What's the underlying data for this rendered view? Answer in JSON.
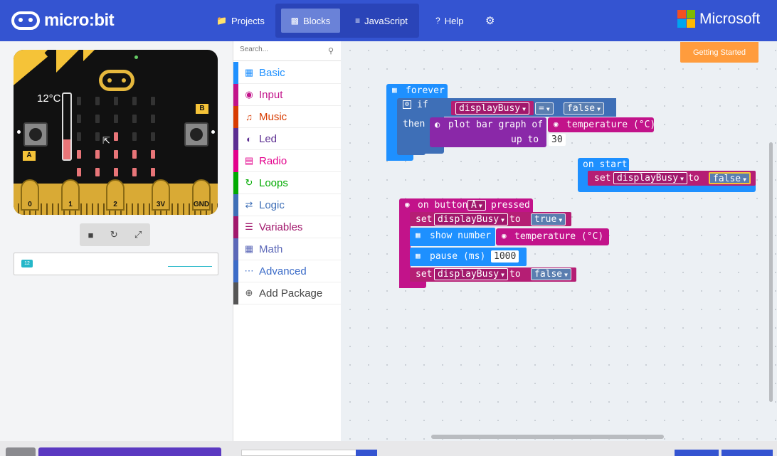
{
  "header": {
    "logo_text": "micro:bit",
    "projects": "Projects",
    "blocks": "Blocks",
    "javascript": "JavaScript",
    "help": "Help",
    "brand": "Microsoft"
  },
  "simulator": {
    "temperature": "12°C",
    "thermometer_level": 0.3,
    "button_a": "A",
    "button_b": "B",
    "pins": [
      "0",
      "1",
      "2",
      "3V",
      "GND"
    ],
    "serial_badge": "12"
  },
  "toolbox": {
    "search_placeholder": "Search...",
    "categories": [
      {
        "label": "Basic",
        "color": "#1e90ff"
      },
      {
        "label": "Input",
        "color": "#c2138a"
      },
      {
        "label": "Music",
        "color": "#d83b01"
      },
      {
        "label": "Led",
        "color": "#5c2d91"
      },
      {
        "label": "Radio",
        "color": "#e3008c"
      },
      {
        "label": "Loops",
        "color": "#00aa00"
      },
      {
        "label": "Logic",
        "color": "#3e6fb7"
      },
      {
        "label": "Variables",
        "color": "#a1186c"
      },
      {
        "label": "Math",
        "color": "#5c68b8"
      },
      {
        "label": "Advanced",
        "color": "#3c6cc8"
      },
      {
        "label": "Add Package",
        "color": "#555555"
      }
    ]
  },
  "workspace": {
    "getting_started": "Getting Started",
    "forever": {
      "label": "forever",
      "if_label": "if",
      "then_label": "then",
      "cond_var": "displayBusy",
      "cond_op": "=",
      "cond_val": "false",
      "plot_label": "plot bar graph of",
      "plot_value": "temperature (°C)",
      "upto_label": "up to",
      "upto_value": "30"
    },
    "on_start": {
      "label": "on start",
      "set_label": "set",
      "var": "displayBusy",
      "to_label": "to",
      "value": "false"
    },
    "on_button": {
      "label_pre": "on button",
      "button": "A",
      "label_post": "pressed",
      "set1_label": "set",
      "set1_var": "displayBusy",
      "set1_to": "to",
      "set1_value": "true",
      "show_label": "show number",
      "show_value": "temperature (°C)",
      "pause_label": "pause (ms)",
      "pause_value": "1000",
      "set2_label": "set",
      "set2_var": "displayBusy",
      "set2_to": "to",
      "set2_value": "false"
    }
  }
}
